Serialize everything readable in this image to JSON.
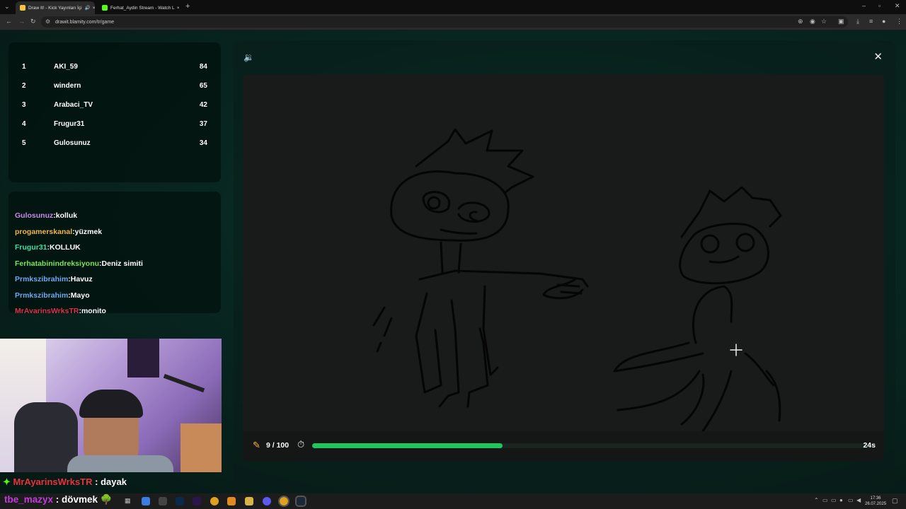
{
  "browser": {
    "tabs": [
      {
        "title": "Draw It! - Kick Yayınları İçi"
      },
      {
        "title": "Ferhat_Aydin Stream - Watch L"
      }
    ],
    "url": "drawit.blamity.com/tr/game"
  },
  "leaderboard": [
    {
      "rank": "1",
      "name": "AKI_59",
      "score": "84"
    },
    {
      "rank": "2",
      "name": "windern",
      "score": "65"
    },
    {
      "rank": "3",
      "name": "Arabaci_TV",
      "score": "42"
    },
    {
      "rank": "4",
      "name": "Frugur31",
      "score": "37"
    },
    {
      "rank": "5",
      "name": "Gulosunuz",
      "score": "34"
    }
  ],
  "guesses": [
    {
      "user": "Gulosunuz",
      "sep": ":",
      "text": "kolluk",
      "color": "#c98be6"
    },
    {
      "user": "progamerskanal",
      "sep": ":",
      "text": "yüzmek",
      "color": "#f0b54a"
    },
    {
      "user": "Frugur31",
      "sep": ":",
      "text": "KOLLUK",
      "color": "#3fe0a0"
    },
    {
      "user": "Ferhatabinindreksiyonu",
      "sep": ":",
      "text": "Deniz simiti",
      "color": "#7ce35a"
    },
    {
      "user": "Prmkszibrahim",
      "sep": ":",
      "text": "Havuz",
      "color": "#6fa8f0"
    },
    {
      "user": "Prmkszibrahim",
      "sep": ":",
      "text": "Mayo",
      "color": "#6fa8f0"
    },
    {
      "user": "MrAyarinsWrksTR",
      "sep": ":",
      "text": "monito",
      "color": "#e0304a"
    }
  ],
  "game": {
    "round": "9 / 100",
    "progress": 0.34,
    "timer": "24s",
    "accent": "#21c55d"
  },
  "stream_chat": [
    {
      "user": "MrAyarinsWrksTR",
      "sep": " : ",
      "text": "dayak",
      "color": "#e8323c"
    },
    {
      "user": "tbe_mazyx",
      "sep": " : ",
      "text": "dövmek",
      "color": "#c53adb"
    }
  ],
  "clock": {
    "time": "17:36",
    "date": "26.07.2025"
  }
}
